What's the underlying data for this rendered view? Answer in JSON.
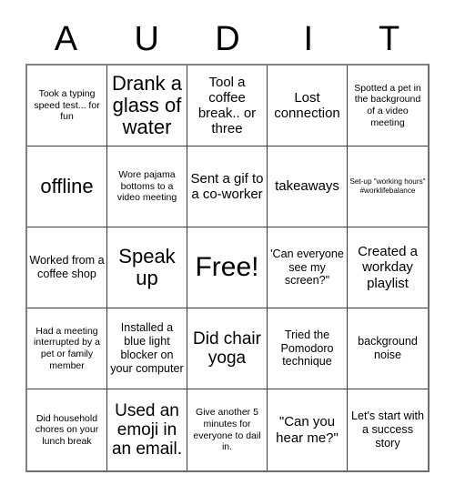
{
  "header": {
    "letters": [
      "A",
      "U",
      "D",
      "I",
      "T"
    ]
  },
  "card": {
    "title_letters": "AUDIT",
    "columns": 5,
    "rows": 5,
    "cells": [
      {
        "text": "Took a typing speed test... for fun",
        "size": "t-s"
      },
      {
        "text": "Drank a glass of water",
        "size": "t-xxl"
      },
      {
        "text": "Tool a coffee break.. or three",
        "size": "t-l"
      },
      {
        "text": "Lost connection",
        "size": "t-l"
      },
      {
        "text": "Spotted a pet in the background of a video meeting",
        "size": "t-s"
      },
      {
        "text": "offline",
        "size": "t-xxl"
      },
      {
        "text": "Wore pajama bottoms to a video meeting",
        "size": "t-s"
      },
      {
        "text": "Sent a gif to a co-worker",
        "size": "t-l"
      },
      {
        "text": "takeaways",
        "size": "t-l"
      },
      {
        "text": "Set-up \"working hours\" #worklifebalance",
        "size": "t-xs"
      },
      {
        "text": "Worked from a coffee shop",
        "size": "t-m"
      },
      {
        "text": "Speak up",
        "size": "t-xxl"
      },
      {
        "text": "Free!",
        "size": "t-free"
      },
      {
        "text": "'Can everyone see my screen?\"",
        "size": "t-m"
      },
      {
        "text": "Created a workday playlist",
        "size": "t-l"
      },
      {
        "text": "Had a meeting interrupted by a pet or family member",
        "size": "t-s"
      },
      {
        "text": "Installed a blue light blocker on your computer",
        "size": "t-m"
      },
      {
        "text": "Did chair yoga",
        "size": "t-xl"
      },
      {
        "text": "Tried the Pomodoro technique",
        "size": "t-m"
      },
      {
        "text": "background noise",
        "size": "t-m"
      },
      {
        "text": "Did household chores on your lunch break",
        "size": "t-s"
      },
      {
        "text": "Used an emoji in an email.",
        "size": "t-xl"
      },
      {
        "text": "Give another 5 minutes for everyone to dail in.",
        "size": "t-s"
      },
      {
        "text": "\"Can you hear me?\"",
        "size": "t-l"
      },
      {
        "text": "Let's start with a success story",
        "size": "t-m"
      }
    ]
  },
  "colors": {
    "background": "#ffffff",
    "text": "#000000",
    "grid_line": "#3a3a3a",
    "outer_border": "#808080"
  }
}
